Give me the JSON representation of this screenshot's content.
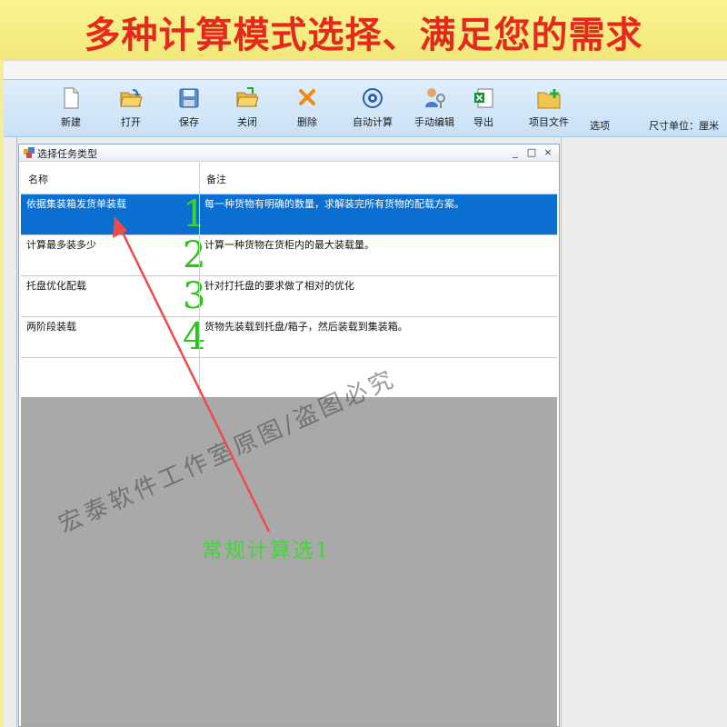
{
  "banner": {
    "title": "多种计算模式选择、满足您的需求",
    "color": "#e4291d"
  },
  "toolbar": {
    "buttons": [
      {
        "label": "新建",
        "icon": "new-file-icon"
      },
      {
        "label": "打开",
        "icon": "open-folder-icon"
      },
      {
        "label": "保存",
        "icon": "save-disk-icon"
      },
      {
        "label": "关闭",
        "icon": "close-folder-icon"
      },
      {
        "label": "删除",
        "icon": "delete-x-icon"
      },
      {
        "label": "自动计算",
        "icon": "auto-calc-icon"
      },
      {
        "label": "手动编辑",
        "icon": "manual-edit-icon"
      },
      {
        "label": "导出",
        "icon": "export-excel-icon"
      },
      {
        "label": "项目文件",
        "icon": "project-folder-icon"
      }
    ],
    "options_label": "选项",
    "unit_label": "尺寸单位：厘米"
  },
  "dialog": {
    "title": "选择任务类型",
    "controls": {
      "minimize": "_",
      "maximize": "□",
      "close": "×"
    },
    "columns": [
      "名称",
      "备注"
    ],
    "rows": [
      {
        "name": "依据集装箱发货单装载",
        "note": "每一种货物有明确的数量，求解装完所有货物的配载方案。",
        "number": "1",
        "selected": true
      },
      {
        "name": "计算最多装多少",
        "note": "计算一种货物在货柜内的最大装载量。",
        "number": "2",
        "selected": false
      },
      {
        "name": "托盘优化配载",
        "note": "针对打托盘的要求做了相对的优化",
        "number": "3",
        "selected": false
      },
      {
        "name": "两阶段装载",
        "note": "货物先装载到托盘/箱子，然后装载到集装箱。",
        "number": "4",
        "selected": false
      }
    ]
  },
  "overlay": {
    "watermark": "宏泰软件工作室原图/盗图必究",
    "callout": "常规计算选1",
    "callout_color": "#45d43a",
    "arrow_color": "#ee4b4b"
  },
  "colors": {
    "selection": "#0a6fd0",
    "banner_bg": "#f4ee9a",
    "number_green": "#2ec21e"
  }
}
